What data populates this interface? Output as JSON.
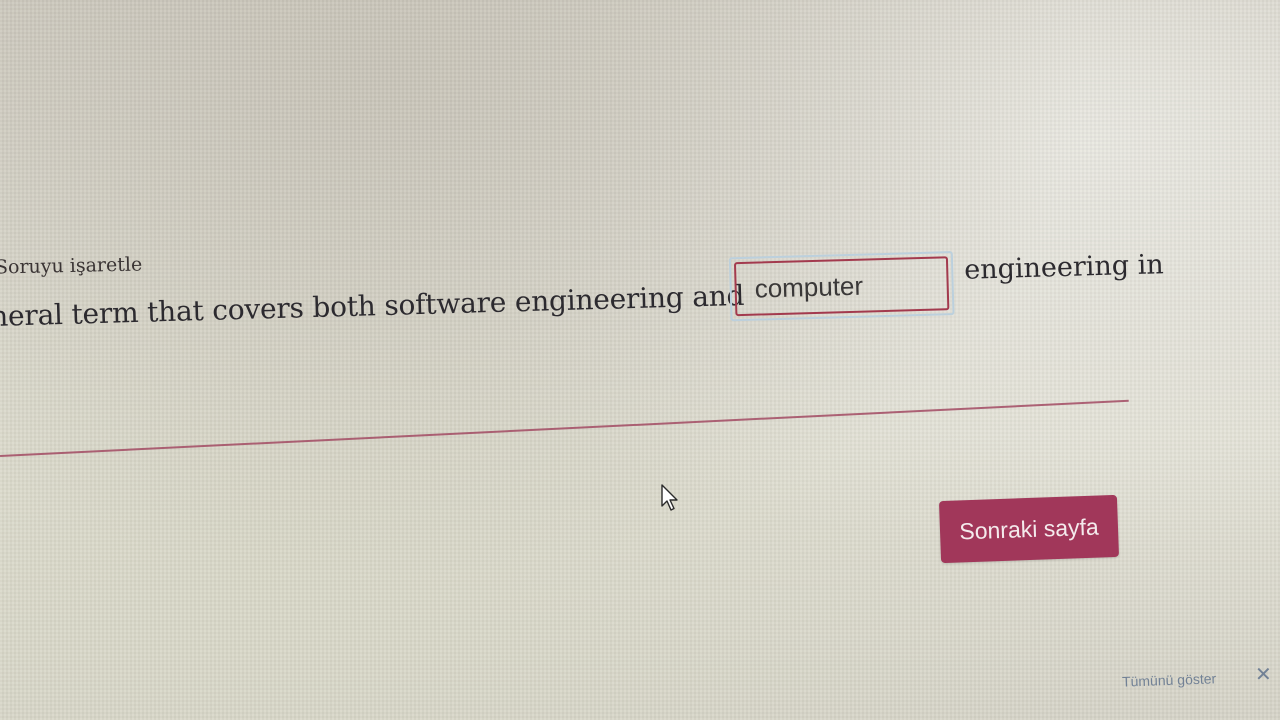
{
  "question": {
    "flag_label": "Soruyu işaretle",
    "text_before": "neral term that covers both software engineering and",
    "answer_value": "computer",
    "text_after": "engineering in"
  },
  "navigation": {
    "next_page_label": "Sonraki sayfa"
  },
  "notification": {
    "show_all_label": "Tümünü göster",
    "close_icon": "close-icon"
  },
  "colors": {
    "accent": "#a1375a",
    "input_border": "#a33a4e",
    "focus_ring": "#bcd0dd"
  }
}
